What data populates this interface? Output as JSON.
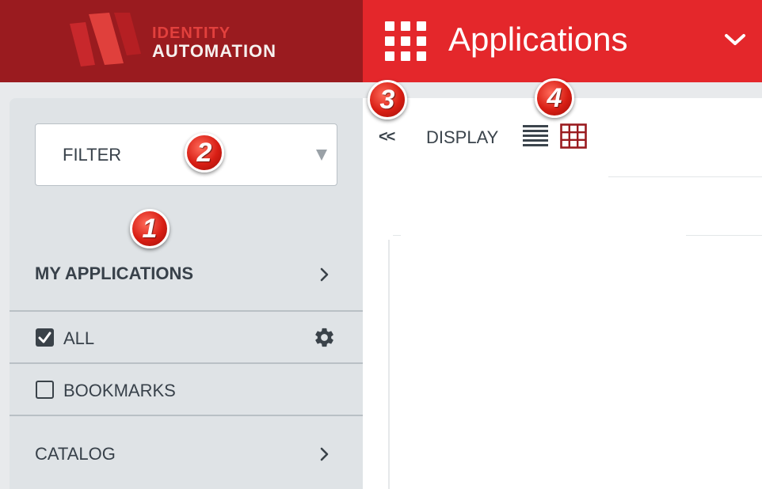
{
  "header": {
    "brand_line1": "IDENTITY",
    "brand_line2": "AUTOMATION",
    "title": "Applications",
    "apps_icon": "apps-grid-icon",
    "menu_icon": "chevron-down-icon",
    "colors": {
      "brand_dark": "#9a1b1f",
      "brand_red": "#e4272b"
    }
  },
  "sidebar": {
    "filter": {
      "label": "FILTER",
      "icon": "dropdown-caret-icon"
    },
    "my_applications": {
      "label": "MY APPLICATIONS",
      "icon": "chevron-right-icon"
    },
    "items": [
      {
        "label": "ALL",
        "checked": true,
        "action_icon": "gear-icon"
      },
      {
        "label": "BOOKMARKS",
        "checked": false
      }
    ],
    "catalog": {
      "label": "CATALOG",
      "icon": "chevron-right-icon"
    }
  },
  "toolbar": {
    "collapse_label": "<<",
    "display_label": "DISPLAY",
    "views": [
      {
        "icon": "list-view-icon",
        "active": false
      },
      {
        "icon": "grid-view-icon",
        "active": true
      }
    ]
  },
  "callouts": [
    "1",
    "2",
    "3",
    "4"
  ]
}
